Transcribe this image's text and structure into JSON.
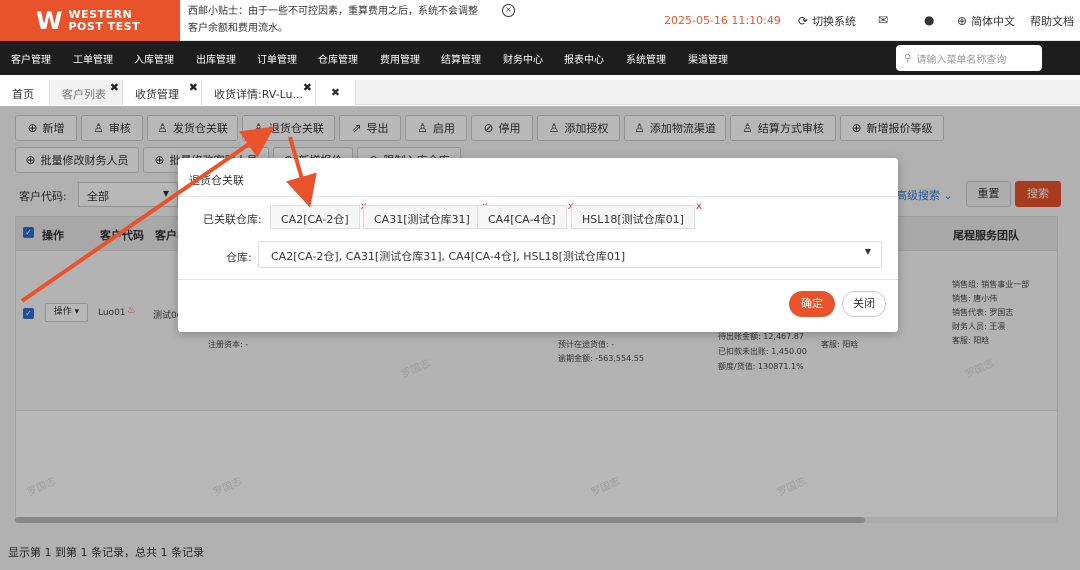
{
  "header": {
    "logo_line1": "WESTERN",
    "logo_line2": "POST TEST",
    "tip_line1": "西邮小贴士：由于一些不可控因素，重算费用之后，系统不会调整",
    "tip_line2": "客户余额和费用流水。",
    "datetime": "2025-05-16 11:10:49",
    "switch_system": "切换系统",
    "language": "简体中文",
    "help": "帮助文档"
  },
  "nav": {
    "items": [
      "客户管理",
      "工单管理",
      "入库管理",
      "出库管理",
      "订单管理",
      "仓库管理",
      "费用管理",
      "结算管理",
      "财务中心",
      "报表中心",
      "系统管理",
      "渠道管理"
    ],
    "search_placeholder": "请输入菜单名称查询"
  },
  "tabs": [
    "首页",
    "客户列表",
    "收货管理",
    "收货详情:RV-Lu..."
  ],
  "toolbar": {
    "row1": [
      "新增",
      "审核",
      "发货仓关联",
      "退货仓关联",
      "导出",
      "启用",
      "停用",
      "添加授权",
      "添加物流渠道",
      "结算方式审核",
      "新增报价等级"
    ],
    "row2": [
      "批量修改财务人员",
      "批量修改客服人员",
      "新增报价",
      "限制入库仓库"
    ]
  },
  "filter": {
    "label": "客户代码:",
    "value": "全部",
    "advanced": "高级搜索",
    "reset": "重置",
    "search": "搜索"
  },
  "table": {
    "headers": [
      "操作",
      "客户代码",
      "客户名称",
      "尾程服务团队"
    ],
    "row": {
      "op": "操作",
      "code": "Luo01",
      "name": "测试00",
      "reg_capital": "注册资本: -",
      "in_transit": "预计在途货值: -",
      "overdue": "逾期金额: -563,554.55",
      "pending": "待出账金额: 12,467.87",
      "deducted": "已扣款未出账: 1,450.00",
      "quota": "额度/货值: 130871.1%",
      "cs_mid": "客服: 阳晗",
      "team": [
        "销售组: 销售事业一部",
        "销售: 唐小伟",
        "销售代表: 罗国志",
        "财务人员: 王凛",
        "客服: 阳晗"
      ]
    }
  },
  "footer": "显示第 1 到第 1 条记录，总共 1 条记录",
  "watermark": "罗国志",
  "dialog": {
    "title": "退货仓关联",
    "linked_label": "已关联仓库:",
    "chips": [
      "CA2[CA-2仓]",
      "CA31[测试仓库31]",
      "CA4[CA-4仓]",
      "HSL18[测试仓库01]"
    ],
    "chip_remove": "x",
    "warehouse_label": "仓库:",
    "warehouse_value": "CA2[CA-2仓], CA31[测试仓库31], CA4[CA-4仓], HSL18[测试仓库01]",
    "ok": "确定",
    "close": "关闭"
  },
  "colors": {
    "brand": "#e8532b",
    "nav_bg": "#1d1d1d",
    "annotation_arrow": "#e8532b"
  }
}
